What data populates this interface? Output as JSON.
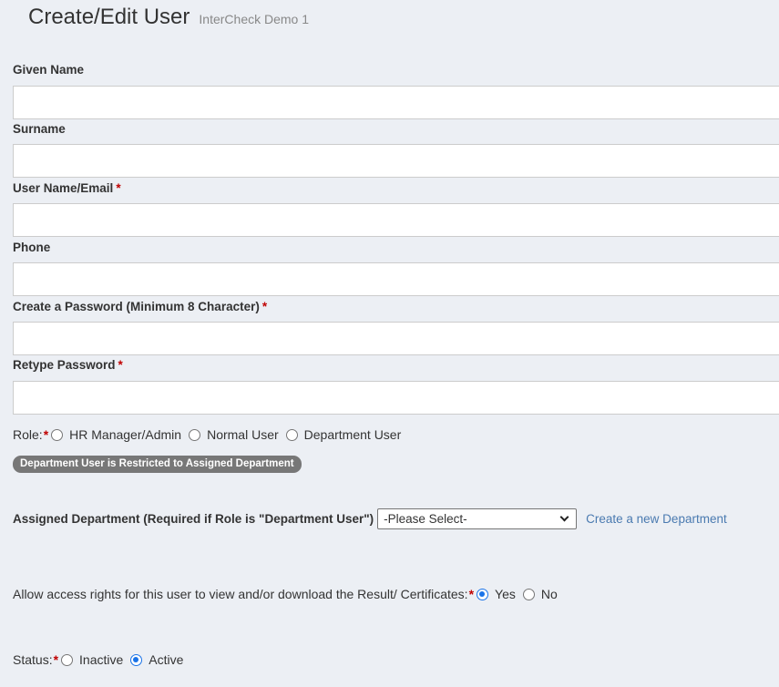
{
  "header": {
    "title": "Create/Edit User",
    "subtitle": "InterCheck Demo 1"
  },
  "form": {
    "given_name": {
      "label": "Given Name",
      "value": ""
    },
    "surname": {
      "label": "Surname",
      "value": ""
    },
    "username": {
      "label": "User Name/Email",
      "value": "",
      "required_mark": "*"
    },
    "phone": {
      "label": "Phone",
      "value": ""
    },
    "password": {
      "label": "Create a Password (Minimum 8 Character)",
      "value": "",
      "required_mark": "*"
    },
    "retype_password": {
      "label": "Retype Password",
      "value": "",
      "required_mark": "*"
    }
  },
  "role": {
    "label": "Role:",
    "required_mark": "*",
    "options": [
      "HR Manager/Admin",
      "Normal User",
      "Department User"
    ],
    "selected": null
  },
  "badge": {
    "text": "Department User is Restricted to Assigned Department"
  },
  "department": {
    "label": "Assigned Department (Required if Role is \"Department User\")",
    "selected": "-Please Select-",
    "create_link": "Create a new Department"
  },
  "access": {
    "label": "Allow access rights for this user to view and/or download the Result/ Certificates:",
    "required_mark": "*",
    "options": [
      "Yes",
      "No"
    ],
    "selected": "Yes"
  },
  "status": {
    "label": "Status:",
    "required_mark": "*",
    "options": [
      "Inactive",
      "Active"
    ],
    "selected": "Active"
  },
  "colors": {
    "background": "#eceff4",
    "required": "#c00000",
    "link": "#4a7ab0",
    "radio_accent": "#1a73e8",
    "badge": "#777777"
  }
}
